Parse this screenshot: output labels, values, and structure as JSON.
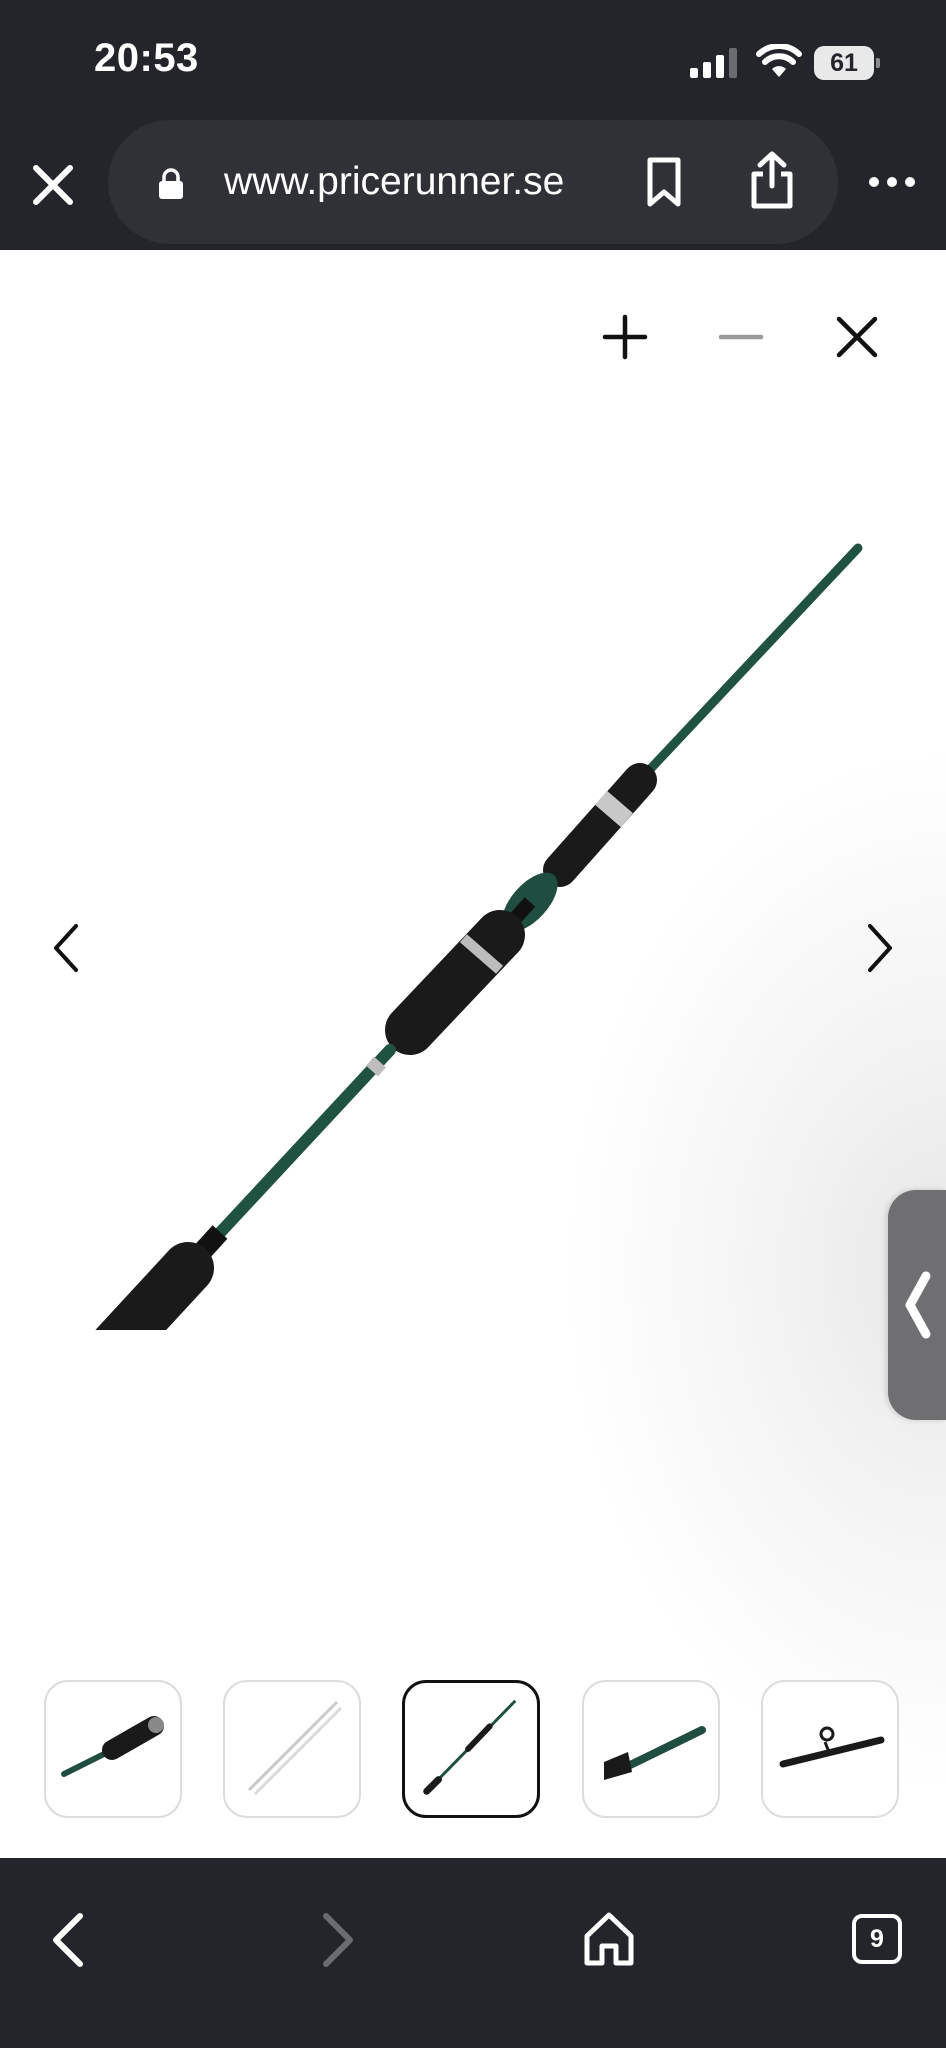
{
  "status_bar": {
    "time": "20:53",
    "battery_level": "61",
    "signal_icon": "cellular-signal-icon",
    "wifi_icon": "wifi-icon"
  },
  "browser": {
    "url": "www.pricerunner.se",
    "buttons": [
      "close-icon",
      "lock-icon",
      "bookmark-icon",
      "share-icon",
      "more-icon"
    ]
  },
  "viewer": {
    "controls": [
      "zoom-in-icon",
      "zoom-out-icon",
      "close-icon"
    ],
    "image": "fishing-rod",
    "navigation": [
      "chevron-left-icon",
      "chevron-right-icon"
    ],
    "thumbnails": [
      {
        "image": "rod-handle-closeup",
        "selected": false
      },
      {
        "image": "rod-white-blank",
        "selected": false
      },
      {
        "image": "rod-full-view",
        "selected": true
      },
      {
        "image": "rod-grip-detail",
        "selected": false
      },
      {
        "image": "rod-reel-seat",
        "selected": false
      }
    ]
  },
  "bottom_toolbar": {
    "tab_count": "9",
    "buttons": [
      "back-icon",
      "forward-icon",
      "home-icon",
      "tabs-icon"
    ]
  },
  "colors": {
    "chrome_background": "#23252a",
    "url_pill": "#2f3137",
    "rod_green": "#1f4d3f",
    "grip_black": "#1a1a1a"
  }
}
